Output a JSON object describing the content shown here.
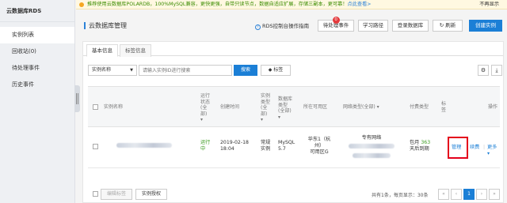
{
  "sidebar": {
    "title": "云数据库RDS",
    "items": [
      {
        "label": "实例列表",
        "active": true
      },
      {
        "label": "回收站(0)"
      },
      {
        "label": "待处理事件"
      },
      {
        "label": "历史事件"
      }
    ]
  },
  "notice": {
    "text": "推荐使用云数据库POLARDB，100%MySQL兼容，更快更强，自带只读节点，数据自适应扩展，存储三副本，更可靠！",
    "link": "点此查看>",
    "close": "不再显示"
  },
  "header": {
    "title": "云数据库管理",
    "guide": "RDS控制台操作指南",
    "buttons": {
      "pending": "待处理事件",
      "pending_badge": "0",
      "learn": "学习路径",
      "login": "登录数据库",
      "refresh": "刷新",
      "create": "创建实例"
    }
  },
  "tabs": [
    "基本信息",
    "标签信息"
  ],
  "toolbar": {
    "select_value": "实例名称",
    "search_placeholder": "请输入实例ID进行搜索",
    "search_label": "搜索",
    "tag_label": "标签"
  },
  "table": {
    "headers": {
      "name": "实例名称",
      "status": [
        "运行",
        "状态",
        "(全",
        "部)"
      ],
      "created": "创建时间",
      "type": [
        "实例",
        "类型",
        "(全",
        "部)"
      ],
      "db_type": [
        "数据库",
        "类型",
        "(全部)"
      ],
      "zone": "所在可用区",
      "network": "网络类型(全部)",
      "billing": "付费类型",
      "tag": [
        "标",
        "签"
      ],
      "ops": "操作"
    },
    "rows": [
      {
        "status": [
          "运行",
          "中"
        ],
        "created": [
          "2019-02-18",
          "18:04"
        ],
        "type": [
          "常规",
          "实例"
        ],
        "db": [
          "MySQL",
          "5.7"
        ],
        "zone": [
          "华东1（杭",
          "州）",
          "可用区G"
        ],
        "network": "专有网络",
        "billing": [
          "包月",
          "363",
          "天后到期"
        ],
        "manage": "管理",
        "renew": "续费",
        "more": "更多"
      }
    ]
  },
  "footer": {
    "edit_tags": "编辑标签",
    "grant": "实例授权",
    "total": "共有1条，每页显示：30条",
    "pages": [
      "«",
      "‹",
      "1",
      "›",
      "»"
    ],
    "current_page": "1"
  },
  "colors": {
    "primary": "#1b7fd6",
    "highlight": "#e4001b",
    "success": "#3c9b20"
  }
}
